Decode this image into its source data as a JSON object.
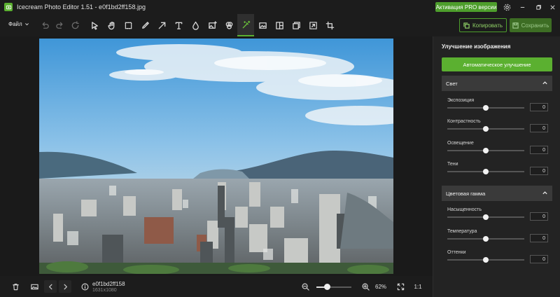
{
  "window": {
    "title": "Icecream Photo Editor 1.51 - e0f1bd2ff158.jpg",
    "pro_button": "Активация PRO версии"
  },
  "toolbar": {
    "file_menu": "Файл",
    "copy_label": "Копировать",
    "save_label": "Сохранить",
    "active_tool": "enhance",
    "accent_color": "#5bb030"
  },
  "image_info": {
    "filename": "e0f1bd2ff158",
    "dimensions": "1631x1080"
  },
  "zoom": {
    "label": "62%",
    "fraction": 0.3,
    "one_to_one": "1:1"
  },
  "panel": {
    "title": "Улучшение изображения",
    "auto_button": "Автоматическое улучшение",
    "sections": [
      {
        "name": "Свет",
        "sliders": [
          {
            "label": "Экспозиция",
            "value": "0",
            "level": 0.5
          },
          {
            "label": "Контрастность",
            "value": "0",
            "level": 0.5
          },
          {
            "label": "Освещение",
            "value": "0",
            "level": 0.5
          },
          {
            "label": "Тени",
            "value": "0",
            "level": 0.5
          }
        ]
      },
      {
        "name": "Цветовая гамма",
        "sliders": [
          {
            "label": "Насыщенность",
            "value": "0",
            "level": 0.5
          },
          {
            "label": "Температура",
            "value": "0",
            "level": 0.5
          },
          {
            "label": "Оттенки",
            "value": "0",
            "level": 0.5
          }
        ]
      }
    ]
  }
}
